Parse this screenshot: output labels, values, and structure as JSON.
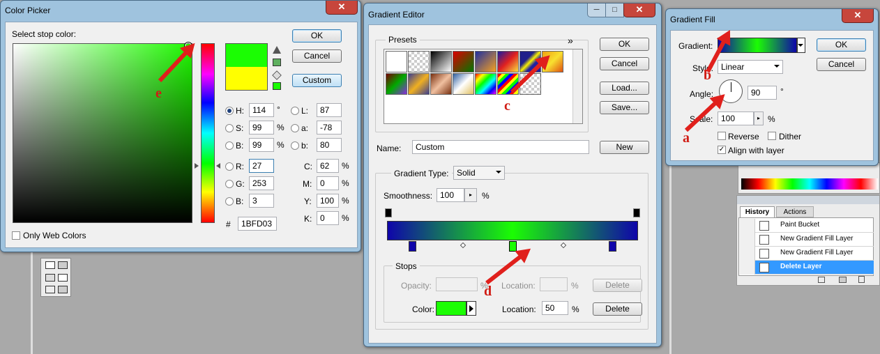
{
  "colors": {
    "accent_red": "#e0201c",
    "current_color": "#1BFD03",
    "old_color": "#ffff00",
    "gradient_blue": "#0f05aa",
    "gradient_green": "#1BFD03",
    "history_selected": "#3399ff"
  },
  "color_picker": {
    "title": "Color Picker",
    "close": "✕",
    "select_stop_label": "Select stop color:",
    "ok": "OK",
    "cancel": "Cancel",
    "custom": "Custom",
    "h_label": "H:",
    "h_value": "114",
    "h_unit": "°",
    "s_label": "S:",
    "s_value": "99",
    "s_unit": "%",
    "b_label": "B:",
    "b_value": "99",
    "b_unit": "%",
    "r_label": "R:",
    "r_value": "27",
    "g_label": "G:",
    "g_value": "253",
    "b2_label": "B:",
    "b2_value": "3",
    "l_label": "L:",
    "l_value": "87",
    "a_label": "a:",
    "a_value": "-78",
    "bb_label": "b:",
    "bb_value": "80",
    "c_label": "C:",
    "c_value": "62",
    "c_unit": "%",
    "m_label": "M:",
    "m_value": "0",
    "m_unit": "%",
    "y_label": "Y:",
    "y_value": "100",
    "y_unit": "%",
    "k_label": "K:",
    "k_value": "0",
    "k_unit": "%",
    "hex_label": "#",
    "hex_value": "1BFD03",
    "only_web_colors": "Only Web Colors",
    "annotation": "e"
  },
  "gradient_editor": {
    "title": "Gradient Editor",
    "minimize": "─",
    "maximize": "□",
    "close": "✕",
    "presets_label": "Presets",
    "presets_menu": "»",
    "ok": "OK",
    "cancel": "Cancel",
    "load": "Load...",
    "save": "Save...",
    "name_label": "Name:",
    "name_value": "Custom",
    "new": "New",
    "gradient_type_label": "Gradient Type:",
    "gradient_type_value": "Solid",
    "smoothness_label": "Smoothness:",
    "smoothness_value": "100",
    "smoothness_unit": "%",
    "stops_label": "Stops",
    "opacity_label": "Opacity:",
    "opacity_unit": "%",
    "location_label": "Location:",
    "location_unit": "%",
    "delete": "Delete",
    "color_label": "Color:",
    "location2_label": "Location:",
    "location2_value": "50",
    "location2_unit": "%",
    "delete2": "Delete",
    "annotation_c": "c",
    "annotation_d": "d"
  },
  "gradient_fill": {
    "title": "Gradient Fill",
    "close": "✕",
    "gradient_label": "Gradient:",
    "ok": "OK",
    "cancel": "Cancel",
    "style_label": "Style:",
    "style_value": "Linear",
    "angle_label": "Angle:",
    "angle_value": "90",
    "angle_unit": "°",
    "scale_label": "Scale:",
    "scale_value": "100",
    "scale_unit": "%",
    "reverse": "Reverse",
    "dither": "Dither",
    "align": "Align with layer",
    "annotation_a": "a",
    "annotation_b": "b"
  },
  "history": {
    "tab_history": "History",
    "tab_actions": "Actions",
    "items": [
      {
        "label": "Paint Bucket"
      },
      {
        "label": "New Gradient Fill Layer"
      },
      {
        "label": "New Gradient Fill Layer"
      },
      {
        "label": "Delete Layer"
      }
    ]
  }
}
